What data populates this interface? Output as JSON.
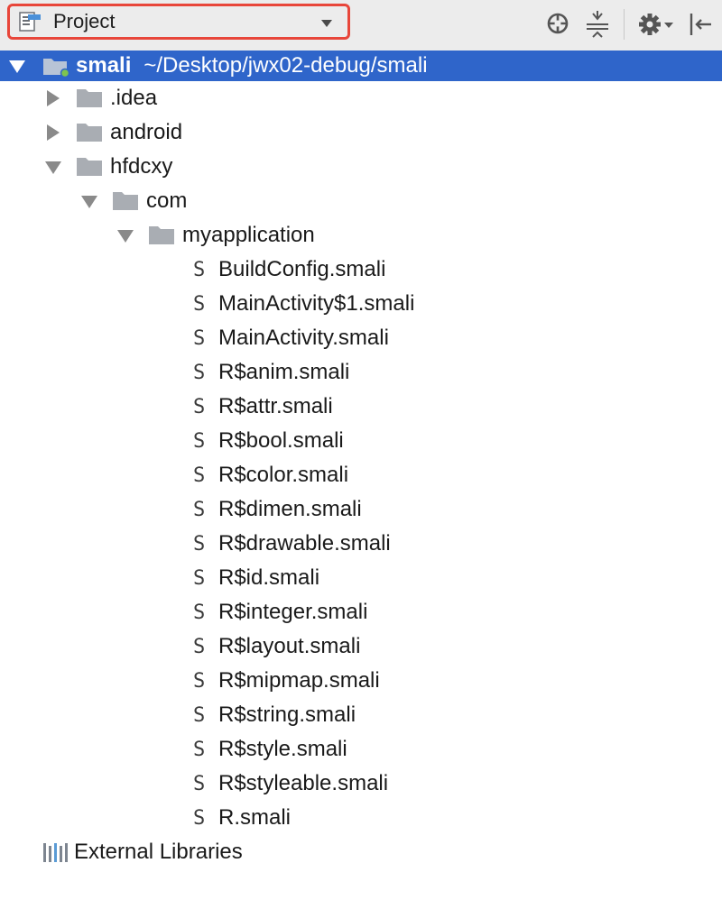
{
  "toolbar": {
    "view_label": "Project",
    "buttons": [
      "locate-icon",
      "collapse-all-icon",
      "gear-icon",
      "hide-icon"
    ]
  },
  "tree": {
    "root": {
      "name": "smali",
      "path": "~/Desktop/jwx02-debug/smali"
    },
    "folders": {
      "idea": ".idea",
      "android": "android",
      "hfdcxy": "hfdcxy",
      "com": "com",
      "myapplication": "myapplication"
    },
    "files": [
      "BuildConfig.smali",
      "MainActivity$1.smali",
      "MainActivity.smali",
      "R$anim.smali",
      "R$attr.smali",
      "R$bool.smali",
      "R$color.smali",
      "R$dimen.smali",
      "R$drawable.smali",
      "R$id.smali",
      "R$integer.smali",
      "R$layout.smali",
      "R$mipmap.smali",
      "R$string.smali",
      "R$style.smali",
      "R$styleable.smali",
      "R.smali"
    ],
    "file_glyph": "S",
    "external_libraries": "External Libraries"
  },
  "colors": {
    "selection": "#2f65ca",
    "highlight_border": "#e8463a",
    "folder": "#a9adb3"
  }
}
